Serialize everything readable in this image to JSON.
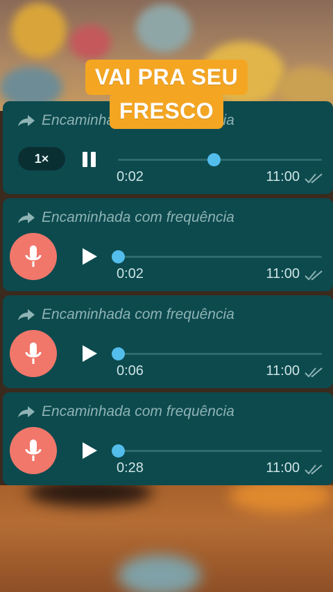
{
  "caption": {
    "line1": "VAI PRA SEU",
    "line2": "FRESCO"
  },
  "messages": [
    {
      "forwarded_label": "Encaminhada com frequência",
      "speed": "1×",
      "state": "playing",
      "progress": 0.47,
      "duration": "0:02",
      "time": "11:00",
      "read_icon": "double-check-icon"
    },
    {
      "forwarded_label": "Encaminhada com frequência",
      "state": "paused",
      "progress": 0.0,
      "duration": "0:02",
      "time": "11:00",
      "read_icon": "double-check-icon"
    },
    {
      "forwarded_label": "Encaminhada com frequência",
      "state": "paused",
      "progress": 0.0,
      "duration": "0:06",
      "time": "11:00",
      "read_icon": "double-check-icon"
    },
    {
      "forwarded_label": "Encaminhada com frequência",
      "state": "paused",
      "progress": 0.0,
      "duration": "0:28",
      "time": "11:00",
      "read_icon": "double-check-icon"
    }
  ],
  "colors": {
    "card_bg": "#0c4a4e",
    "caption_bg": "#f4a623",
    "progress_knob": "#53bdeb",
    "mic_avatar": "#f0776a"
  },
  "icons": [
    "forward-icon",
    "pause-icon",
    "play-icon",
    "microphone-icon",
    "double-check-icon"
  ]
}
